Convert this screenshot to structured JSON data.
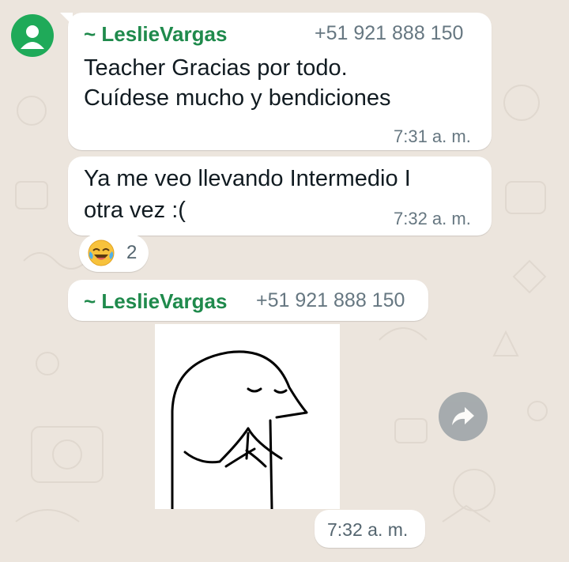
{
  "colors": {
    "chat_background": "#ece5dd",
    "bubble": "#ffffff",
    "sender_name": "#1f8a4c",
    "avatar": "#1faa59",
    "meta_text": "#667781"
  },
  "messages": [
    {
      "sender": "~ LeslieVargas",
      "phone": "+51 921 888 150",
      "lines": [
        "Teacher Gracias por todo.",
        "Cuídese mucho y bendiciones"
      ],
      "time": "7:31 a. m."
    },
    {
      "lines": [
        "Ya me veo llevando Intermedio I",
        "otra vez :("
      ],
      "time": "7:32 a. m.",
      "reaction": {
        "emoji": "😂",
        "count": "2"
      }
    },
    {
      "sender": "~ LeslieVargas",
      "phone": "+51 921 888 150",
      "sticker_icon": "praying-blob-sticker",
      "time": "7:32 a. m."
    }
  ],
  "icons": {
    "avatar": "default-contact-avatar-icon",
    "forward": "forward-arrow-icon"
  }
}
